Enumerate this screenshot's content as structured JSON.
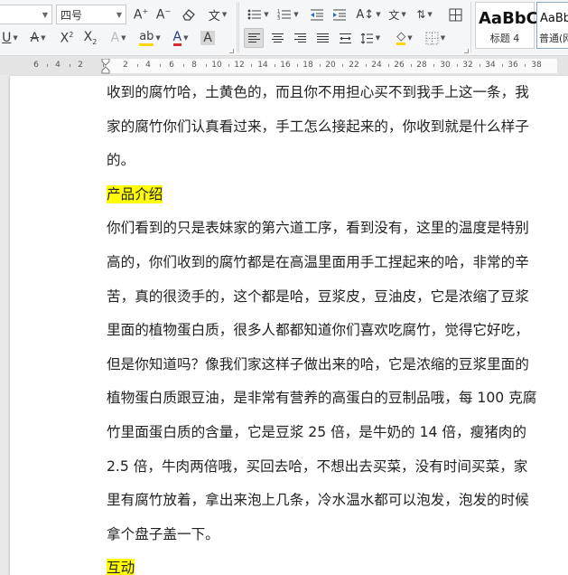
{
  "toolbar": {
    "font_size": "四号",
    "style_gallery": [
      {
        "sample": "AaBbC",
        "name": "标题 4"
      },
      {
        "sample": "AaBb",
        "name": "普通(网"
      }
    ]
  },
  "ruler": {
    "numbers": [
      "6",
      "4",
      "2",
      "2",
      "4",
      "6",
      "8",
      "10",
      "12",
      "14",
      "16",
      "18",
      "20",
      "22",
      "24",
      "26",
      "28",
      "30",
      "32",
      "34",
      "36",
      "38"
    ]
  },
  "document": {
    "lines": [
      {
        "text": "收到的腐竹哈，土黄色的，而且你不用担心买不到我手上这一条，我",
        "highlight": false
      },
      {
        "text": "家的腐竹你们认真看过来，手工怎么接起来的，你收到就是什么样子",
        "highlight": false
      },
      {
        "text": "的。",
        "highlight": false
      },
      {
        "text": "产品介绍",
        "highlight": true
      },
      {
        "text": "你们看到的只是表妹家的第六道工序，看到没有，这里的温度是特别",
        "highlight": false
      },
      {
        "text": "高的，你们收到的腐竹都是在高温里面用手工捏起来的哈，非常的辛",
        "highlight": false
      },
      {
        "text": "苦，真的很烫手的，这个都是哈，豆浆皮，豆油皮，它是浓缩了豆浆",
        "highlight": false
      },
      {
        "text": "里面的植物蛋白质，很多人都都知道你们喜欢吃腐竹，觉得它好吃，",
        "highlight": false
      },
      {
        "text": "但是你知道吗？像我们家这样子做出来的哈，它是浓缩的豆浆里面的",
        "highlight": false
      },
      {
        "text": "植物蛋白质跟豆油，是非常有营养的高蛋白的豆制品哦，每 100 克腐",
        "highlight": false
      },
      {
        "text": "竹里面蛋白质的含量，它是豆浆 25 倍，是牛奶的 14 倍，瘦猪肉的",
        "highlight": false
      },
      {
        "text": "2.5 倍，牛肉两倍哦，买回去哈，不想出去买菜，没有时间买菜，家",
        "highlight": false
      },
      {
        "text": "里有腐竹放着，拿出来泡上几条，冷水温水都可以泡发，泡发的时候",
        "highlight": false
      },
      {
        "text": "拿个盘子盖一下。",
        "highlight": false
      },
      {
        "text": "互动",
        "highlight": true
      }
    ]
  },
  "colors": {
    "highlight": "#ffff00",
    "font_color_underline": "#d32f2f",
    "highlighter_bar": "#ffd400",
    "shading_bar": "#ffd400"
  }
}
